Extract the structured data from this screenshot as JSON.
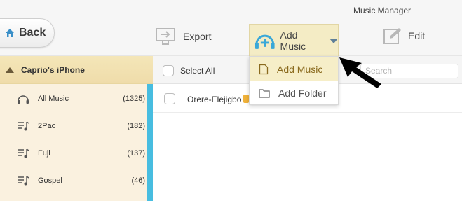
{
  "window": {
    "title": "Music Manager"
  },
  "toolbar": {
    "back_label": "Back",
    "export_label": "Export",
    "add_music_label": "Add Music",
    "edit_label": "Edit"
  },
  "sidebar": {
    "device_name": "Caprio's iPhone",
    "items": [
      {
        "label": "All Music",
        "count": "(1325)",
        "icon": "headphones-icon"
      },
      {
        "label": "2Pac",
        "count": "(182)",
        "icon": "playlist-icon"
      },
      {
        "label": "Fuji",
        "count": "(137)",
        "icon": "playlist-icon"
      },
      {
        "label": "Gospel",
        "count": "(46)",
        "icon": "playlist-icon"
      }
    ]
  },
  "list": {
    "select_all_label": "Select All",
    "search_placeholder": "Search",
    "rows": [
      {
        "title": "Orere-Elejigbo"
      }
    ]
  },
  "dropdown": {
    "items": [
      {
        "label": "Add Music",
        "icon": "file-icon"
      },
      {
        "label": "Add Folder",
        "icon": "folder-icon"
      }
    ]
  },
  "colors": {
    "accent_blue": "#47bde0",
    "highlight": "#f6eec8",
    "sidebar_bg": "#faf1df"
  }
}
